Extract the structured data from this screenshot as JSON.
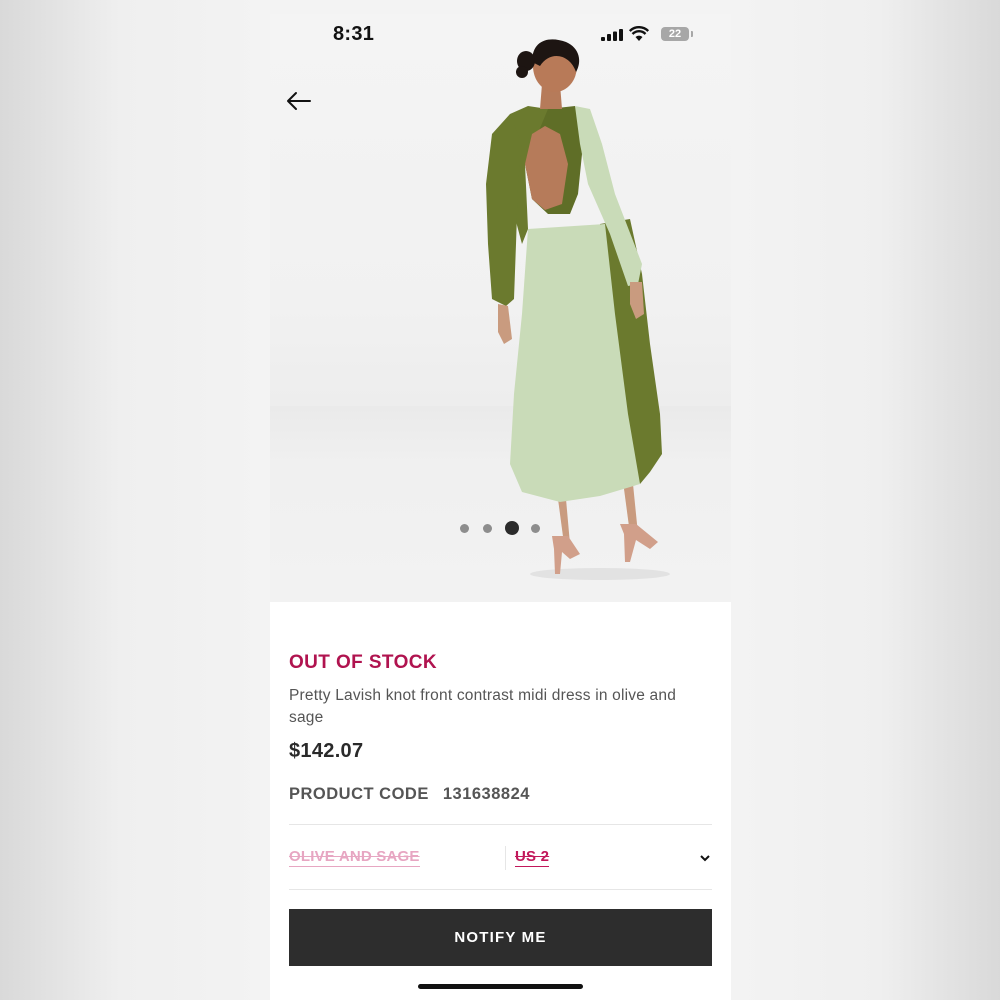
{
  "status_bar": {
    "time": "8:31",
    "battery": "22"
  },
  "product": {
    "stock_status": "OUT OF STOCK",
    "title": "Pretty Lavish knot front contrast midi dress in olive and sage",
    "price": "$142.07",
    "code_label": "PRODUCT CODE",
    "code_value": "131638824",
    "color": "OLIVE AND SAGE",
    "size": "US 2",
    "notify_label": "NOTIFY ME"
  },
  "gallery": {
    "image_count": 4,
    "active_index": 2
  },
  "colors": {
    "stock_status": "#b0134f",
    "button_bg": "#2d2d2d",
    "disabled_color_option": "#e7a6c2",
    "disabled_size_option": "#c2185b",
    "dress_olive": "#6b7a2e",
    "dress_sage": "#c9dbb8"
  },
  "icons": [
    "back-arrow-icon",
    "cellular-signal-icon",
    "wifi-icon",
    "battery-icon",
    "chevron-down-icon"
  ]
}
